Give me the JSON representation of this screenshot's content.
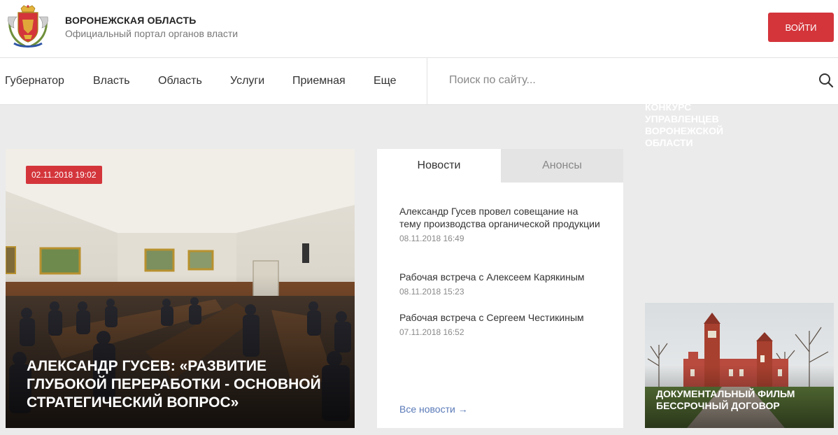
{
  "header": {
    "title": "ВОРОНЕЖСКАЯ ОБЛАСТЬ",
    "subtitle": "Официальный портал органов власти",
    "login_label": "ВОЙТИ",
    "logo_icon": "coat-of-arms-icon"
  },
  "nav": {
    "items": [
      {
        "label": "Губернатор"
      },
      {
        "label": "Власть"
      },
      {
        "label": "Область"
      },
      {
        "label": "Услуги"
      },
      {
        "label": "Приемная"
      },
      {
        "label": "Еще"
      }
    ],
    "search_placeholder": "Поиск по сайту...",
    "search_icon": "search-icon"
  },
  "promo": {
    "text": "КОНКУРС УПРАВЛЕНЦЕВ ВОРОНЕЖСКОЙ ОБЛАСТИ"
  },
  "hero": {
    "date": "02.11.2018 19:02",
    "title": "АЛЕКСАНДР ГУСЕВ: «РАЗВИТИЕ ГЛУБОКОЙ ПЕРЕРАБОТКИ - ОСНОВНОЙ СТРАТЕГИЧЕСКИЙ ВОПРОС»"
  },
  "news_panel": {
    "tabs": [
      {
        "label": "Новости",
        "active": true
      },
      {
        "label": "Анонсы",
        "active": false
      }
    ],
    "items": [
      {
        "title": "Александр Гусев провел совещание на тему производства органической продукции",
        "date": "08.11.2018 16:49"
      },
      {
        "title": "Рабочая встреча с Алексеем Карякиным",
        "date": "08.11.2018 15:23"
      },
      {
        "title": "Рабочая встреча с Сергеем Честикиным",
        "date": "07.11.2018 16:52"
      }
    ],
    "all_news_label": "Все новости →"
  },
  "film": {
    "title": "ДОКУМЕНТАЛЬНЫЙ ФИЛЬМ БЕССРОЧНЫЙ ДОГОВОР"
  },
  "colors": {
    "accent_red": "#d3353b",
    "link_blue": "#5a7ab8",
    "page_bg": "#ebebeb"
  }
}
